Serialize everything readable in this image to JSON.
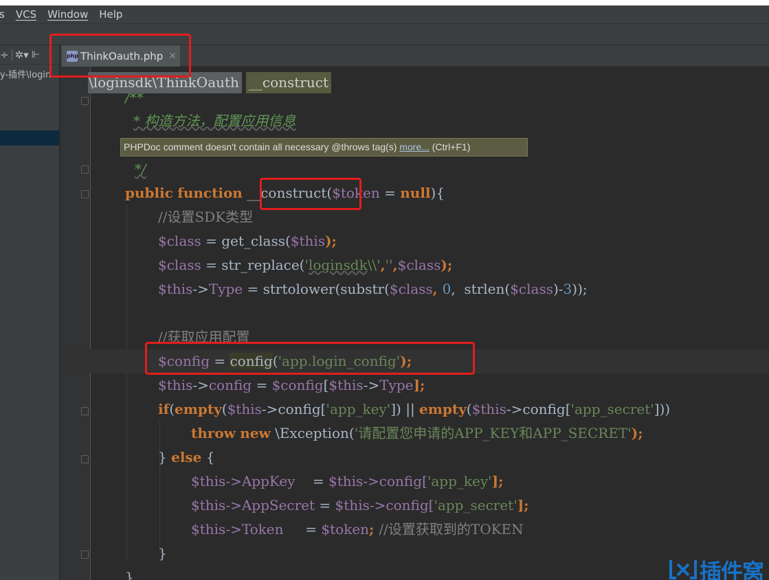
{
  "menu": {
    "items": [
      "s",
      "VCS",
      "Window",
      "Help"
    ]
  },
  "project_panel": {
    "toolbar_icons": [
      "divide-icon",
      "gear-icon",
      "layout-icon"
    ],
    "path_text": "y-插件\\login"
  },
  "tabs": [
    {
      "label": "ThinkOauth.php",
      "icon": "php-file-icon",
      "active": true
    }
  ],
  "breadcrumb": {
    "namespace": "\\loginsdk\\ThinkOauth",
    "method": "__construct"
  },
  "tooltip": {
    "message": "PHPDoc comment doesn't contain all necessary @throws tag(s) ",
    "link": "more...",
    "shortcut": " (Ctrl+F1)"
  },
  "code": {
    "doc_open": "/**",
    "doc_desc": "* 构造方法，配置应用信息",
    "doc_close": "*/",
    "sig": {
      "public": "public",
      "function": "function",
      "name": "__construct",
      "open": "(",
      "param": "$token",
      "eq": " = ",
      "null": "null",
      "close": "){"
    },
    "c1": "//设置SDK类型",
    "l1": {
      "var": "$class",
      "op": " = get_class(",
      "this": "$this",
      "end": ");"
    },
    "l2": {
      "var": "$class",
      "op": " = str_replace(",
      "s1a": "'",
      "s1b": "loginsdk",
      "s1c": "\\\\'",
      "comma1": ",",
      "s2": "''",
      "comma2": ",",
      "var2": "$class",
      "end": ");"
    },
    "l3": {
      "this": "$this",
      "arrow": "->",
      "prop": "Type",
      "op": " = strtolower(substr(",
      "var": "$class",
      "c1": ", ",
      "n0": "0",
      "c2": ",  strlen(",
      "var2": "$class",
      "m": ")-",
      "n3": "3",
      "end": "));"
    },
    "c2": "//获取应用配置",
    "l4": {
      "var": "$config",
      "op": " = ",
      "fn": "config",
      "po": "(",
      "str": "'app.login_config'",
      "end": ");"
    },
    "l5": {
      "this": "$this",
      "arrow": "->",
      "prop": "config",
      "op": " = ",
      "var": "$config",
      "b1": "[",
      "this2": "$this",
      "arrow2": "->",
      "prop2": "Type",
      "b2": "];"
    },
    "l6": {
      "if": "if",
      "p1": "(",
      "empty1": "empty",
      "p2": "(",
      "this1": "$this",
      "a1": "->config[",
      "s1": "'app_key'",
      "mid": "]) || ",
      "empty2": "empty",
      "p3": "(",
      "this2": "$this",
      "a2": "->config[",
      "s2": "'app_secret'",
      "end": "]))"
    },
    "l7": {
      "throw": "throw",
      "new": "new",
      "cls": " \\Exception(",
      "str": "'请配置您申请的APP_KEY和APP_SECRET'",
      "end": ");"
    },
    "l8": {
      "b": "} ",
      "else": "else",
      "o": " {"
    },
    "l9": {
      "this": "$this",
      "prop": "->AppKey",
      "pad": "    = ",
      "this2": "$this",
      "arr": "->config[",
      "str": "'app_key'",
      "end": "];"
    },
    "l10": {
      "this": "$this",
      "prop": "->AppSecret",
      "pad": " = ",
      "this2": "$this",
      "arr": "->config[",
      "str": "'app_secret'",
      "end": "];"
    },
    "l11": {
      "this": "$this",
      "prop": "->Token",
      "pad": "     = ",
      "var": "$token",
      "semi": "; ",
      "cmt": "//设置获取到的TOKEN"
    },
    "l12": "}",
    "l13": "}"
  },
  "watermark": {
    "text": "插件窝"
  },
  "colors": {
    "keyword": "#cc7832",
    "variable": "#9876aa",
    "string": "#6a8759",
    "comment": "#808080",
    "doc_comment": "#629755",
    "number": "#6897bb",
    "annotation": "#e31d1d"
  }
}
